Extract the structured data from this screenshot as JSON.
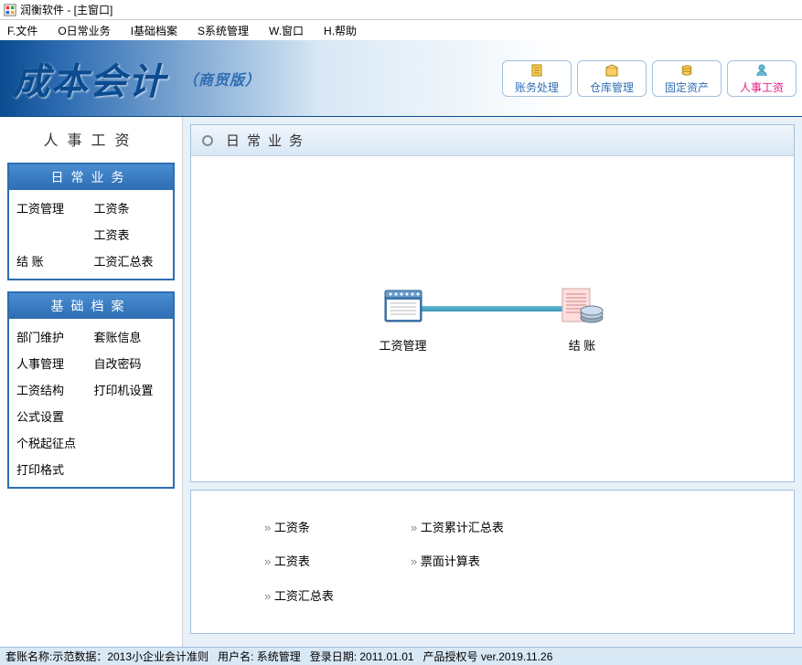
{
  "window": {
    "title": "润衡软件 - [主窗口]"
  },
  "menubar": {
    "items": [
      "F.文件",
      "O日常业务",
      "I基础档案",
      "S系统管理",
      "W.窗口",
      "H.帮助"
    ]
  },
  "header": {
    "logo": "成本会计",
    "subtitle": "（商贸版）",
    "buttons": [
      {
        "label": "账务处理",
        "active": false
      },
      {
        "label": "仓库管理",
        "active": false
      },
      {
        "label": "固定资产",
        "active": false
      },
      {
        "label": "人事工资",
        "active": true
      }
    ]
  },
  "sidebar": {
    "title": "人事工资",
    "panels": [
      {
        "title": "日常业务",
        "items": [
          "工资管理",
          "工资条",
          "",
          "工资表",
          "结 账",
          "工资汇总表"
        ]
      },
      {
        "title": "基础档案",
        "items": [
          "部门维护",
          "套账信息",
          "人事管理",
          "自改密码",
          "工资结构",
          "打印机设置",
          "公式设置",
          "",
          "个税起征点",
          "",
          "打印格式",
          ""
        ]
      }
    ]
  },
  "content": {
    "header": "日常业务",
    "big_icons": [
      {
        "label": "工资管理"
      },
      {
        "label": "结 账"
      }
    ],
    "links_col1": [
      "工资条",
      "工资表",
      "工资汇总表"
    ],
    "links_col2": [
      "工资累计汇总表",
      "票面计算表"
    ]
  },
  "statusbar": {
    "account_label": "套账名称:示范数据：2013小企业会计准则",
    "user_label": "用户名: 系统管理",
    "login_date_label": "登录日期: 2011.01.01",
    "license_label": "产品授权号 ver.2019.11.26"
  }
}
